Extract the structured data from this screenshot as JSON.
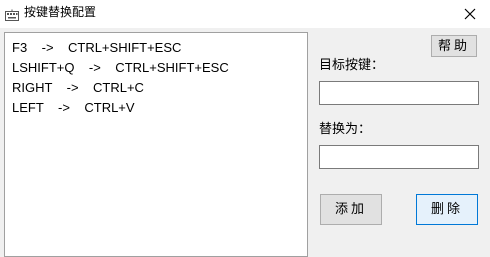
{
  "window": {
    "title": "按键替换配置",
    "icons": {
      "app": "keyboard-icon",
      "close": "close-icon"
    }
  },
  "mappings": [
    "F3    ->    CTRL+SHIFT+ESC",
    "LSHIFT+Q    ->    CTRL+SHIFT+ESC",
    "RIGHT    ->    CTRL+C",
    "LEFT    ->    CTRL+V"
  ],
  "buttons": {
    "help": "帮助",
    "add": "添加",
    "delete": "删除"
  },
  "fields": {
    "target_label": "目标按键：",
    "target_value": "",
    "replace_label": "替换为：",
    "replace_value": ""
  }
}
